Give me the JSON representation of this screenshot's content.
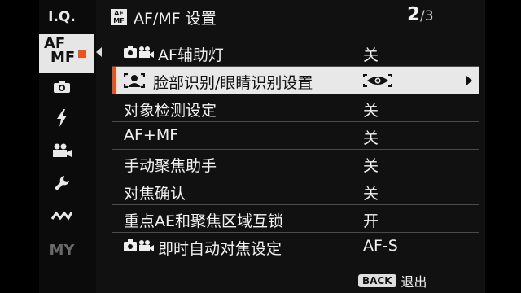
{
  "sidebar": {
    "iq_label": "I.Q.",
    "afmf_label_top": "AF",
    "afmf_label_bottom": "MF",
    "my_label": "MY",
    "items": [
      {
        "icon": "iq-icon"
      },
      {
        "icon": "af-mf-icon"
      },
      {
        "icon": "camera-icon"
      },
      {
        "icon": "flash-icon"
      },
      {
        "icon": "movie-camera-icon"
      },
      {
        "icon": "wrench-icon"
      },
      {
        "icon": "connection-icon"
      },
      {
        "icon": "my-menu-icon"
      }
    ]
  },
  "header": {
    "badge": "AF\nMF",
    "title": "AF/MF 设置",
    "page_current": "2",
    "page_total": "/3"
  },
  "menu": {
    "rows": [
      {
        "label": "AF辅助灯",
        "value": "关",
        "icon": "photo-movie-icon"
      },
      {
        "label": "脸部识别/眼睛识别设置",
        "value": "",
        "value_icon": "eye-detect-icon",
        "icon": "face-detect-icon",
        "selected": true
      },
      {
        "label": "对象检测设定",
        "value": "关"
      },
      {
        "label": "AF+MF",
        "value": "关"
      },
      {
        "label": "手动聚焦助手",
        "value": "关"
      },
      {
        "label": "对焦确认",
        "value": "关"
      },
      {
        "label": "重点AE和聚焦区域互锁",
        "value": "开"
      },
      {
        "label": "即时自动对焦设定",
        "value": "AF-S",
        "icon": "photo-movie-icon"
      }
    ]
  },
  "footer": {
    "back_key": "BACK",
    "back_label": "退出"
  },
  "colors": {
    "accent": "#e8531f",
    "selected_bg": "#e8e8e8"
  }
}
